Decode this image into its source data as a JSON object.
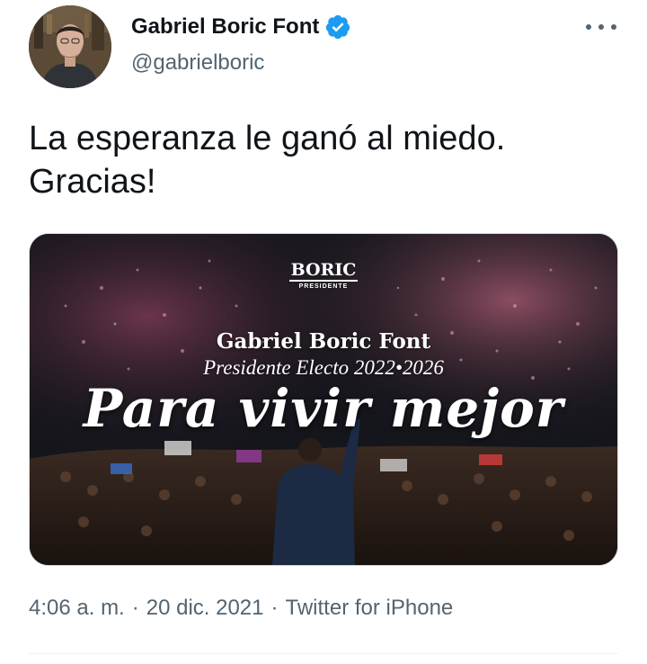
{
  "user": {
    "display_name": "Gabriel Boric Font",
    "handle": "@gabrielboric",
    "verified": true
  },
  "tweet": {
    "text": "La esperanza le ganó al miedo.\nGracias!",
    "time": "4:06 a. m.",
    "separator": "·",
    "date": "20 dic. 2021",
    "source": "Twitter for iPhone"
  },
  "media": {
    "logo_main": "BORIC",
    "logo_sub": "PRESIDENTE",
    "name": "Gabriel Boric Font",
    "subtitle": "Presidente Electo 2022•2026",
    "slogan": "Para vivir mejor"
  },
  "icons": {
    "verified": "verified-badge-icon",
    "more": "more-options-icon"
  },
  "colors": {
    "verified_blue": "#1d9bf0",
    "secondary_text": "#536471",
    "primary_text": "#0f1419"
  }
}
